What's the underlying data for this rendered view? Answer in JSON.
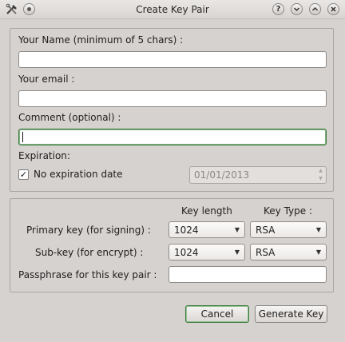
{
  "window": {
    "title": "Create Key Pair",
    "titlebar_buttons": {
      "help": "?",
      "menu": "⌄",
      "maximize": "^",
      "close": "✕"
    }
  },
  "identity": {
    "name_label": "Your Name (minimum of 5 chars) :",
    "name_value": "",
    "email_label": "Your email :",
    "email_value": "",
    "comment_label": "Comment (optional) :",
    "comment_value": "",
    "expiration_label": "Expiration:",
    "no_expiration_label": "No expiration date",
    "no_expiration_checked": true,
    "check_mark": "✓",
    "expiration_date": "01/01/2013"
  },
  "keys": {
    "key_length_header": "Key length",
    "key_type_header": "Key Type :",
    "primary_label": "Primary key (for signing) :",
    "primary_length": "1024",
    "primary_type": "RSA",
    "subkey_label": "Sub-key (for encrypt) :",
    "subkey_length": "1024",
    "subkey_type": "RSA",
    "passphrase_label": "Passphrase for this key pair :",
    "passphrase_value": ""
  },
  "actions": {
    "cancel_label": "Cancel",
    "generate_label": "Generate Key"
  },
  "icons": {
    "app": "tools-icon",
    "minimize": "circle-icon",
    "spin_up": "▲",
    "spin_down": "▼",
    "combo_arrow": "▼"
  },
  "colors": {
    "window_bg": "#d6d2d0",
    "focus_border": "#3e7a3e"
  }
}
